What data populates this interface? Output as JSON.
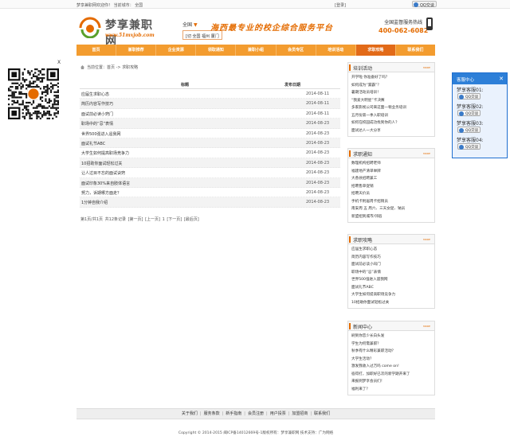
{
  "topbar": {
    "welcome": "梦享兼职网欢迎你！   当前城市： 全国",
    "login": "[登录]",
    "qq_label": "QQ交谈"
  },
  "header": {
    "logo_name": "梦享兼职网",
    "logo_url": "www.51mxjob.com",
    "city_current": "全国",
    "city_caret": "▼",
    "city_options": "全国   福州   厦门",
    "city_prefix": "[切",
    "slogan": "海西最专业的校企综合服务平台",
    "hotline_label": "全国监督服务热线",
    "hotline_number": "400-062-6082"
  },
  "nav": {
    "items": [
      "首页",
      "兼职推荐",
      "企业资源",
      "领取通知",
      "兼职小组",
      "会员专区",
      "培训活动",
      "求职攻略",
      "联系我们"
    ],
    "active_index": 7
  },
  "crumb": "当前位置：首页 -> 求职攻略",
  "list": {
    "col_title": "标题",
    "col_date": "发布日期",
    "rows": [
      {
        "title": "应届生求职心态",
        "date": "2014-08-11"
      },
      {
        "title": "简历内容写作技巧",
        "date": "2014-08-11"
      },
      {
        "title": "面试前必读小窍门",
        "date": "2014-08-11"
      },
      {
        "title": "职场中的“忌”表情",
        "date": "2014-08-23"
      },
      {
        "title": "世界500强进入遥我网",
        "date": "2014-08-23"
      },
      {
        "title": "面试礼节ABC",
        "date": "2014-08-23"
      },
      {
        "title": "大学生如何提高职场竞争力",
        "date": "2014-08-23"
      },
      {
        "title": "10招助你面试轻松过关",
        "date": "2014-08-23"
      },
      {
        "title": "让人过目不忘的面试诀窍",
        "date": "2014-08-23"
      },
      {
        "title": "面试印象30%来自肢体语言",
        "date": "2014-08-23"
      },
      {
        "title": "努力，诉期哪方面走？",
        "date": "2014-08-23"
      },
      {
        "title": "1分钟自我介绍",
        "date": "2014-08-23"
      }
    ],
    "pager": "第1页/共1页   共12条记录 [第一页] [上一页] 1 [下一页] [最后页]"
  },
  "sidebar": {
    "more_label": "MORE",
    "boxes": [
      {
        "title": "培训活动",
        "items": [
          "开学啦 你准备好了吗？",
          "如何成为“漏霸”？",
          "暑期活动员培训！",
          "“我爱大明星”卡决赛",
          "多家影视公司来这面一顿业务培训",
          "五月份第一季入职培训",
          "如何在校园成功找到你的人？",
          "面试达人一大分享"
        ]
      },
      {
        "title": "求职通知",
        "items": [
          "数理机构招聘老师",
          "福建地产清单举牌",
          "大香县招聘兼工",
          "招聘售单促销",
          "招聘天价员",
          "手机卡附居周卡招销员",
          "南安周 五 周六、三天女促、钠员",
          "新盟招到城市/邻宿"
        ]
      },
      {
        "title": "求职攻略",
        "items": [
          "应届生求职心态",
          "简历内容写作技巧",
          "面试前必读小窍门",
          "职场中的“忌”表情",
          "世界500强进入遥我网",
          "面试礼节ABC",
          "大学生如何提高职场竞争力",
          "10招助你面试轻松过关"
        ]
      },
      {
        "title": "新闻中心",
        "items": [
          "刷到你恋少长白头发",
          "学生为何需兼职？",
          "秋季有什么精彩兼职活动？",
          "大学生活动？",
          "激发我收入过万吗 come on!",
          "宿得打，加职好已次的新学期开来了",
          "来报到梦享会员们！",
          "福利来了？"
        ]
      }
    ]
  },
  "qqpanel": {
    "title": "客服中心",
    "close": "✕",
    "services": [
      {
        "name": "梦享客服01:",
        "btn": "QQ交谈"
      },
      {
        "name": "梦享客服02:",
        "btn": "QQ交谈"
      },
      {
        "name": "梦享客服03:",
        "btn": "QQ交谈"
      },
      {
        "name": "梦享客服04:",
        "btn": "QQ交谈"
      }
    ]
  },
  "qr": {
    "close": "X"
  },
  "footer": {
    "links": [
      "关于我们",
      "服务条款",
      "新手指南",
      "会员注册",
      "用户投票",
      "加盟招商",
      "联系我们"
    ],
    "copyright": "Copyright © 2014-2015 闽ICP备14012669号-1版权所有：梦享兼职网 技术支持：广为网络"
  }
}
